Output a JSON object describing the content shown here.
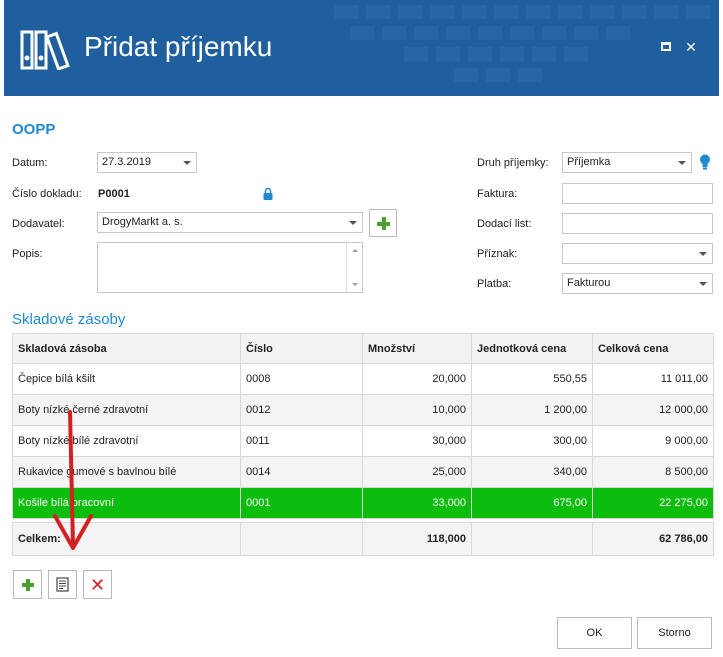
{
  "window": {
    "title": "Přidat příjemku",
    "maximize_icon": "maximize-icon",
    "close_label": "✕"
  },
  "form": {
    "section_title": "OOPP",
    "datum": {
      "label": "Datum:",
      "value": "27.3.2019"
    },
    "cislo_dokladu": {
      "label": "Číslo dokladu:",
      "value": "P0001",
      "lock_icon": "lock-icon"
    },
    "dodavatel": {
      "label": "Dodavatel:",
      "value": "DrogyMarkt a. s."
    },
    "popis": {
      "label": "Popis:",
      "value": ""
    },
    "druh_prijemky": {
      "label": "Druh příjemky:",
      "value": "Příjemka",
      "hint_icon": "lightbulb-icon"
    },
    "faktura": {
      "label": "Faktura:",
      "value": ""
    },
    "dodaci_list": {
      "label": "Dodací list:",
      "value": ""
    },
    "priznak": {
      "label": "Příznak:",
      "value": ""
    },
    "platba": {
      "label": "Platba:",
      "value": "Fakturou"
    }
  },
  "stock": {
    "section_title": "Skladové zásoby",
    "columns": [
      "Skladová zásoba",
      "Číslo",
      "Množství",
      "Jednotková cena",
      "Celková cena"
    ],
    "rows": [
      {
        "name": "Čepice bílá kšilt",
        "cislo": "0008",
        "mnozstvi": "20,000",
        "jednotkova": "550,55",
        "celkova": "11 011,00"
      },
      {
        "name": "Boty nízké černé zdravotní",
        "cislo": "0012",
        "mnozstvi": "10,000",
        "jednotkova": "1 200,00",
        "celkova": "12 000,00"
      },
      {
        "name": "Boty nízké bílé zdravotní",
        "cislo": "0011",
        "mnozstvi": "30,000",
        "jednotkova": "300,00",
        "celkova": "9 000,00"
      },
      {
        "name": "Rukavice gumové s bavlnou bílé",
        "cislo": "0014",
        "mnozstvi": "25,000",
        "jednotkova": "340,00",
        "celkova": "8 500,00"
      },
      {
        "name": "Košile bílá pracovní",
        "cislo": "0001",
        "mnozstvi": "33,000",
        "jednotkova": "675,00",
        "celkova": "22 275,00"
      }
    ],
    "selected_row": 4,
    "total": {
      "label": "Celkem:",
      "mnozstvi": "118,000",
      "celkova": "62 786,00"
    }
  },
  "buttons": {
    "ok": "OK",
    "storno": "Storno"
  },
  "colors": {
    "title_bar": "#1f5f9e",
    "accent": "#1e8ad0",
    "selected_row": "#0dbd0d",
    "add_green": "#49a02e",
    "delete_red": "#d81e1e",
    "annotation_arrow": "#d42020"
  }
}
